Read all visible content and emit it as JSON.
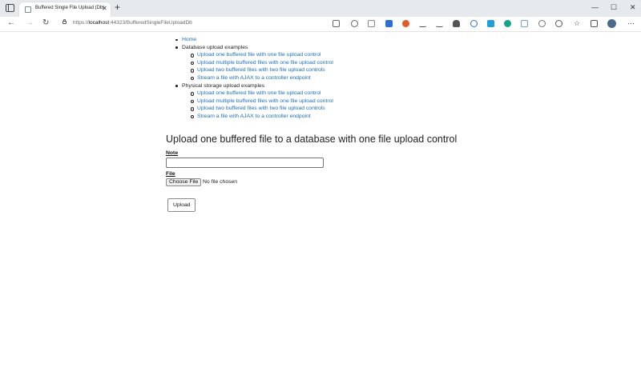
{
  "browser": {
    "tab_title": "Buffered Single File Upload (Db)",
    "tab_close_glyph": "✕",
    "new_tab_glyph": "+",
    "window_controls": {
      "minimize": "—",
      "maximize": "☐",
      "close": "✕"
    },
    "url_scheme": "https://",
    "url_host": "localhost",
    "url_path": ":44323/BufferedSingleFileUploadDb",
    "toolbar_icons": [
      "read-aloud-icon",
      "emoji-icon",
      "extension-icon-1",
      "extension-icon-2",
      "download-icon-1",
      "download-icon-2",
      "cloud-icon",
      "search-ext-icon",
      "grammarly-icon",
      "extension-icon-3",
      "extension-icon-4",
      "settings-ext-icon",
      "favorites-icon",
      "collections-icon",
      "profile-avatar"
    ]
  },
  "nav": {
    "home": "Home",
    "database_section": "Database upload examples",
    "database_links": [
      "Upload one buffered file with one file upload control",
      "Upload multiple buffered files with one file upload control",
      "Upload two buffered files with two file upload controls",
      "Stream a file with AJAX to a controller endpoint"
    ],
    "physical_section": "Physical storage upload examples",
    "physical_links": [
      "Upload one buffered file with one file upload control",
      "Upload multiple buffered files with one file upload control",
      "Upload two buffered files with two file upload controls",
      "Stream a file with AJAX to a controller endpoint"
    ]
  },
  "form": {
    "title": "Upload one buffered file to a database with one file upload control",
    "note_label": "Note",
    "note_value": "",
    "file_label": "File",
    "choose_file_label": "Choose File",
    "file_status": "No file chosen",
    "upload_label": "Upload"
  },
  "colors": {
    "link": "#1a6ec1",
    "titlebar": "#e7eaed",
    "text": "#222222"
  }
}
